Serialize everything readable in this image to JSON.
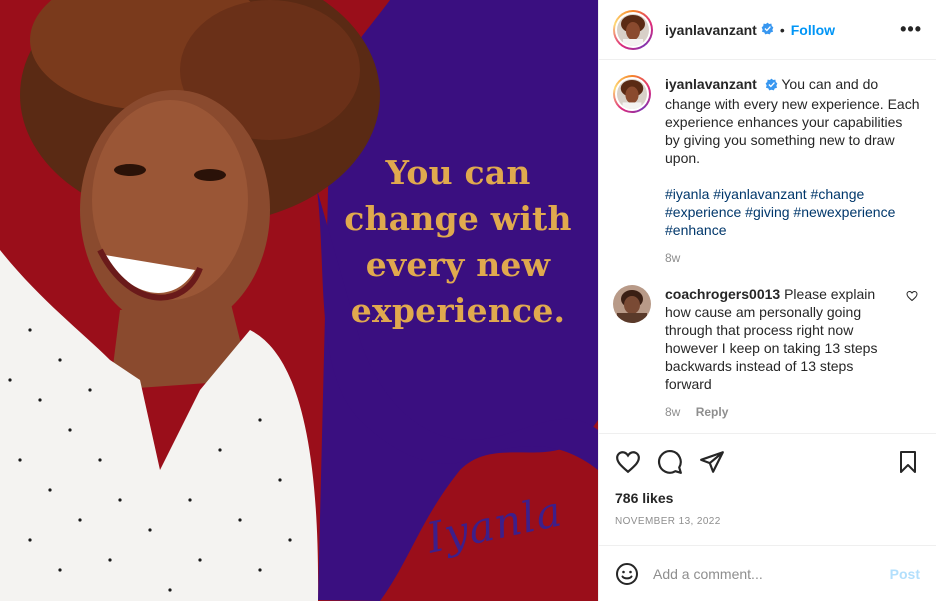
{
  "media": {
    "quote": "You can\nchange with\nevery new\nexperience.",
    "signature": "Iyanla",
    "colors": {
      "red": "#9a0e1a",
      "purple": "#3a0f80",
      "gold": "#e0a94e"
    }
  },
  "header": {
    "username": "iyanlavanzant",
    "follow_label": "Follow",
    "separator": "•",
    "more_label": "•••"
  },
  "caption": {
    "author": "iyanlavanzant",
    "text": "You can and do change with every new experience. Each experience enhances your capabilities by giving you something new to draw upon.",
    "hashtags": "#iyanla #iyanlavanzant #change #experience #giving #newexperience #enhance",
    "age": "8w"
  },
  "comments": [
    {
      "author": "coachrogers0013",
      "text": "Please explain how cause am personally going through that process right now however I keep on taking 13 steps backwards instead of 13 steps forward",
      "age": "8w",
      "reply_label": "Reply"
    }
  ],
  "engagement": {
    "likes": "786 likes",
    "date": "NOVEMBER 13, 2022"
  },
  "add_comment": {
    "placeholder": "Add a comment...",
    "post_label": "Post"
  },
  "icons": [
    "verified-icon",
    "more-icon",
    "heart-icon",
    "comment-icon",
    "share-icon",
    "save-icon",
    "emoji-icon"
  ]
}
